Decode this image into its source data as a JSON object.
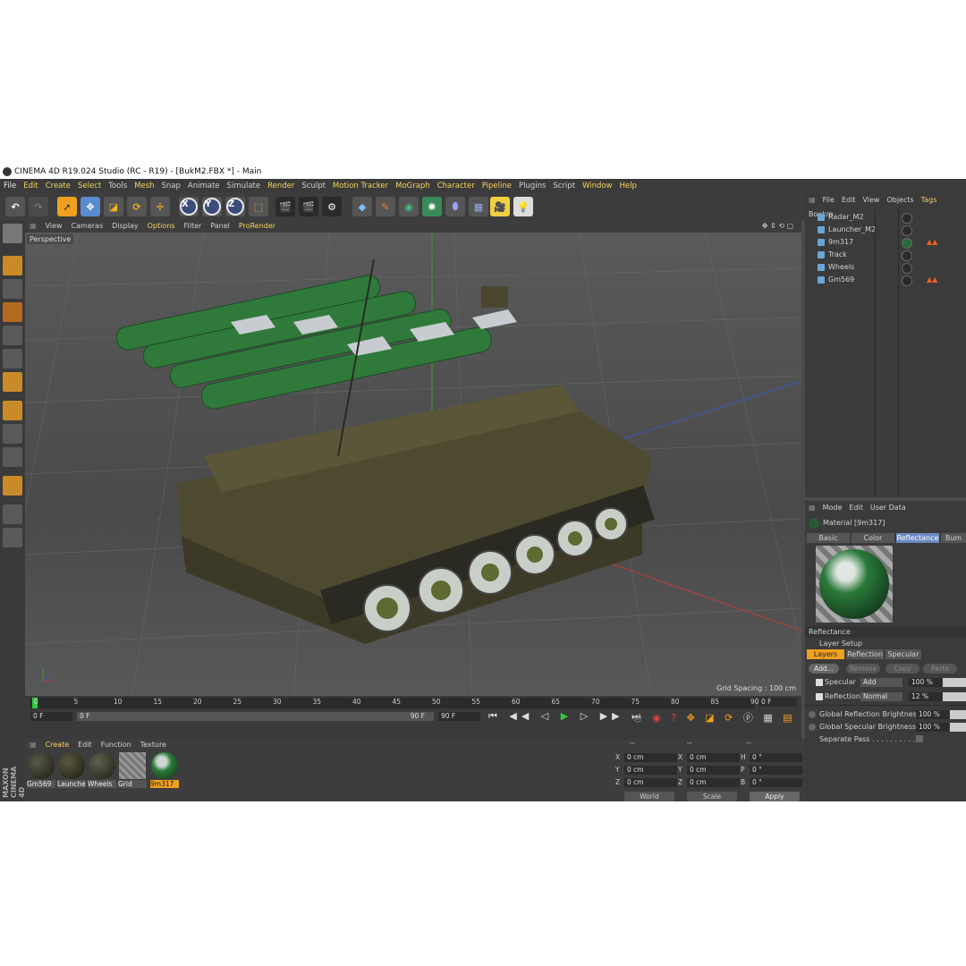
{
  "window": {
    "title": "CINEMA 4D R19.024 Studio (RC - R19) - [BukM2.FBX *] - Main"
  },
  "menubar": [
    "File",
    "Edit",
    "Create",
    "Select",
    "Tools",
    "Mesh",
    "Snap",
    "Animate",
    "Simulate",
    "Render",
    "Sculpt",
    "Motion Tracker",
    "MoGraph",
    "Character",
    "Pipeline",
    "Plugins",
    "Script",
    "Window",
    "Help"
  ],
  "toolbar": {
    "x": "X",
    "y": "Y",
    "z": "Z"
  },
  "viewport": {
    "menu": [
      "View",
      "Cameras",
      "Display",
      "Options",
      "Filter",
      "Panel",
      "ProRender"
    ],
    "label": "Perspective",
    "grid_spacing": "Grid Spacing : 100 cm"
  },
  "timeline": {
    "ticks": [
      "0",
      "5",
      "10",
      "15",
      "20",
      "25",
      "30",
      "35",
      "40",
      "45",
      "50",
      "55",
      "60",
      "65",
      "70",
      "75",
      "80",
      "85",
      "90"
    ],
    "end_frame": "0 F",
    "start_field": "0 F",
    "range_start": "0 F",
    "range_end": "90 F",
    "max_field": "90 F"
  },
  "materials": {
    "menu": [
      "Create",
      "Edit",
      "Function",
      "Texture"
    ],
    "items": [
      "Gm569",
      "Launche",
      "Wheels",
      "Grid",
      "9m317"
    ]
  },
  "coords": {
    "header": [
      "--",
      "--",
      "--"
    ],
    "rows": [
      {
        "a": "X",
        "av": "0 cm",
        "b": "X",
        "bv": "0 cm",
        "c": "H",
        "cv": "0 °"
      },
      {
        "a": "Y",
        "av": "0 cm",
        "b": "Y",
        "bv": "0 cm",
        "c": "P",
        "cv": "0 °"
      },
      {
        "a": "Z",
        "av": "0 cm",
        "b": "Z",
        "bv": "0 cm",
        "c": "B",
        "cv": "0 °"
      }
    ],
    "world": "World",
    "scale": "Scale",
    "apply": "Apply"
  },
  "objects": {
    "menu": [
      "File",
      "Edit",
      "View",
      "Objects",
      "Tags",
      "Bookm"
    ],
    "items": [
      "Radar_M2",
      "Launcher_M2",
      "9m317",
      "Track",
      "Wheels",
      "Gm569"
    ]
  },
  "attributes": {
    "menu": [
      "Mode",
      "Edit",
      "User Data"
    ],
    "material": "Material [9m317]",
    "tabs": [
      "Basic",
      "Color",
      "Reflectance",
      "Bum"
    ],
    "section": "Reflectance",
    "layer_setup": "Layer Setup",
    "subtabs": [
      "Layers",
      "Reflection",
      "Specular"
    ],
    "buttons": [
      "Add...",
      "Remove",
      "Copy",
      "Paste"
    ],
    "layers": [
      {
        "name": "Specular",
        "mode": "Add",
        "value": "100 %"
      },
      {
        "name": "Reflection",
        "mode": "Normal",
        "value": "12 %"
      }
    ],
    "global_refl_label": "Global Reflection Brightness",
    "global_refl": "100 %",
    "global_spec_label": "Global Specular Brightness",
    "global_spec": "100 %",
    "separate_pass": "Separate Pass . . . . . . . . . . ."
  },
  "brand": "MAXON CINEMA 4D"
}
